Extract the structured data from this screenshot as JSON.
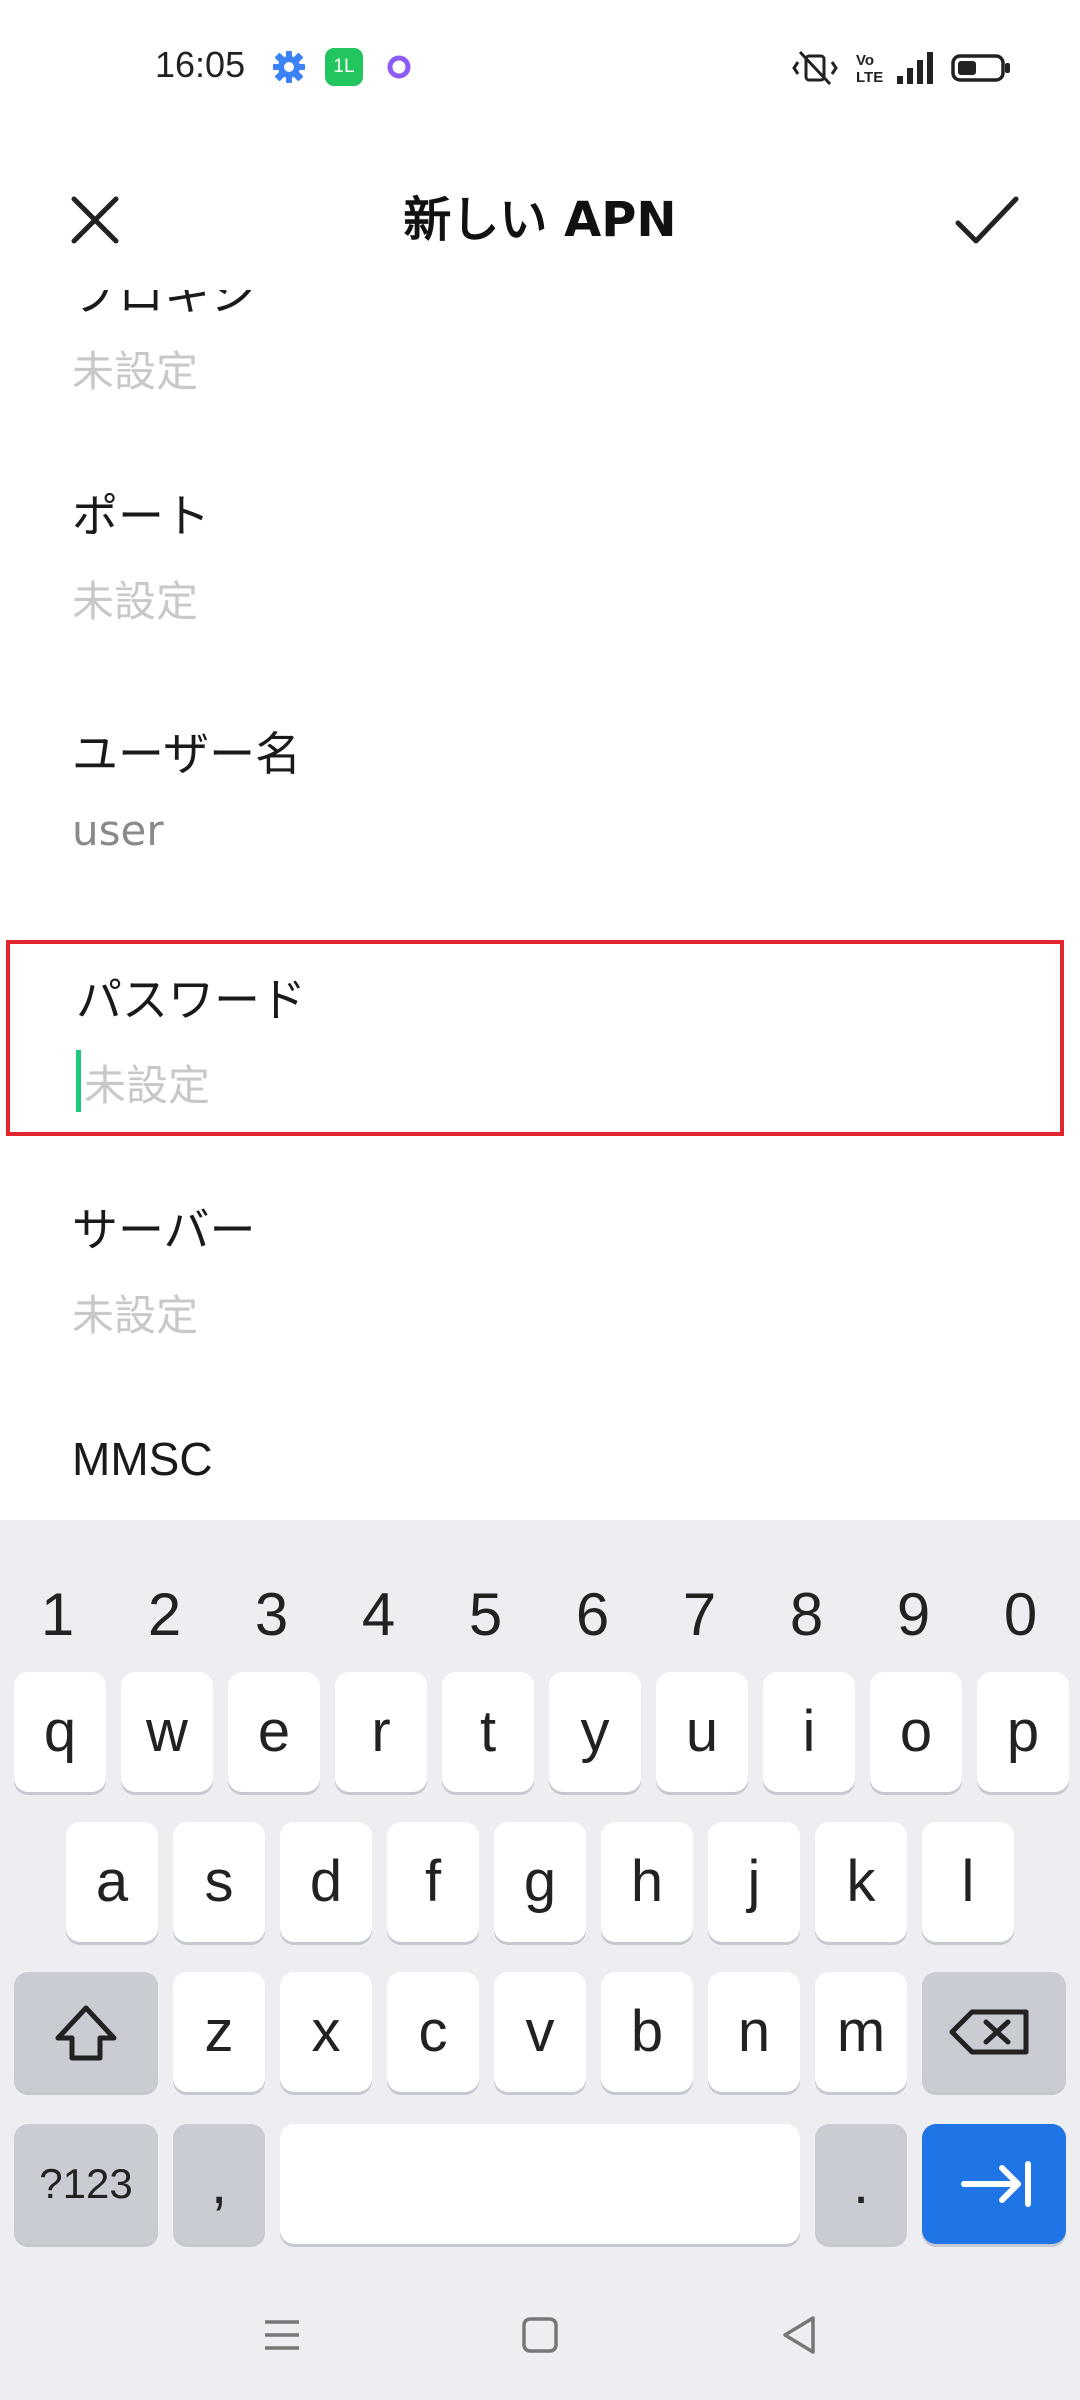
{
  "status": {
    "time": "16:05",
    "icons_left": [
      "settings-gear-icon",
      "green-app-icon",
      "purple-ring-icon"
    ],
    "green_app_text": "1L",
    "icons_right": [
      "vibrate-icon",
      "volte-icon",
      "signal-icon",
      "battery-icon"
    ],
    "volte_text": "Vo\nLTE"
  },
  "app_bar": {
    "title": "新しい APN",
    "close_icon": "close-icon",
    "confirm_icon": "check-icon"
  },
  "fields": {
    "proxy": {
      "label": "プロキシ",
      "value": "未設定"
    },
    "port": {
      "label": "ポート",
      "value": "未設定"
    },
    "username": {
      "label": "ユーザー名",
      "value": "user"
    },
    "password": {
      "label": "パスワード",
      "placeholder": "未設定"
    },
    "server": {
      "label": "サーバー",
      "value": "未設定"
    },
    "mmsc": {
      "label": "MMSC"
    }
  },
  "keyboard": {
    "numbers": [
      "1",
      "2",
      "3",
      "4",
      "5",
      "6",
      "7",
      "8",
      "9",
      "0"
    ],
    "row1": [
      "q",
      "w",
      "e",
      "r",
      "t",
      "y",
      "u",
      "i",
      "o",
      "p"
    ],
    "row2": [
      "a",
      "s",
      "d",
      "f",
      "g",
      "h",
      "j",
      "k",
      "l"
    ],
    "row3": [
      "z",
      "x",
      "c",
      "v",
      "b",
      "n",
      "m"
    ],
    "symbols_label": "?123",
    "comma_label": ",",
    "period_label": ".",
    "accent_color": "#1f74e6"
  },
  "colors": {
    "highlight": "#e0252c",
    "cursor": "#1ec97a"
  }
}
